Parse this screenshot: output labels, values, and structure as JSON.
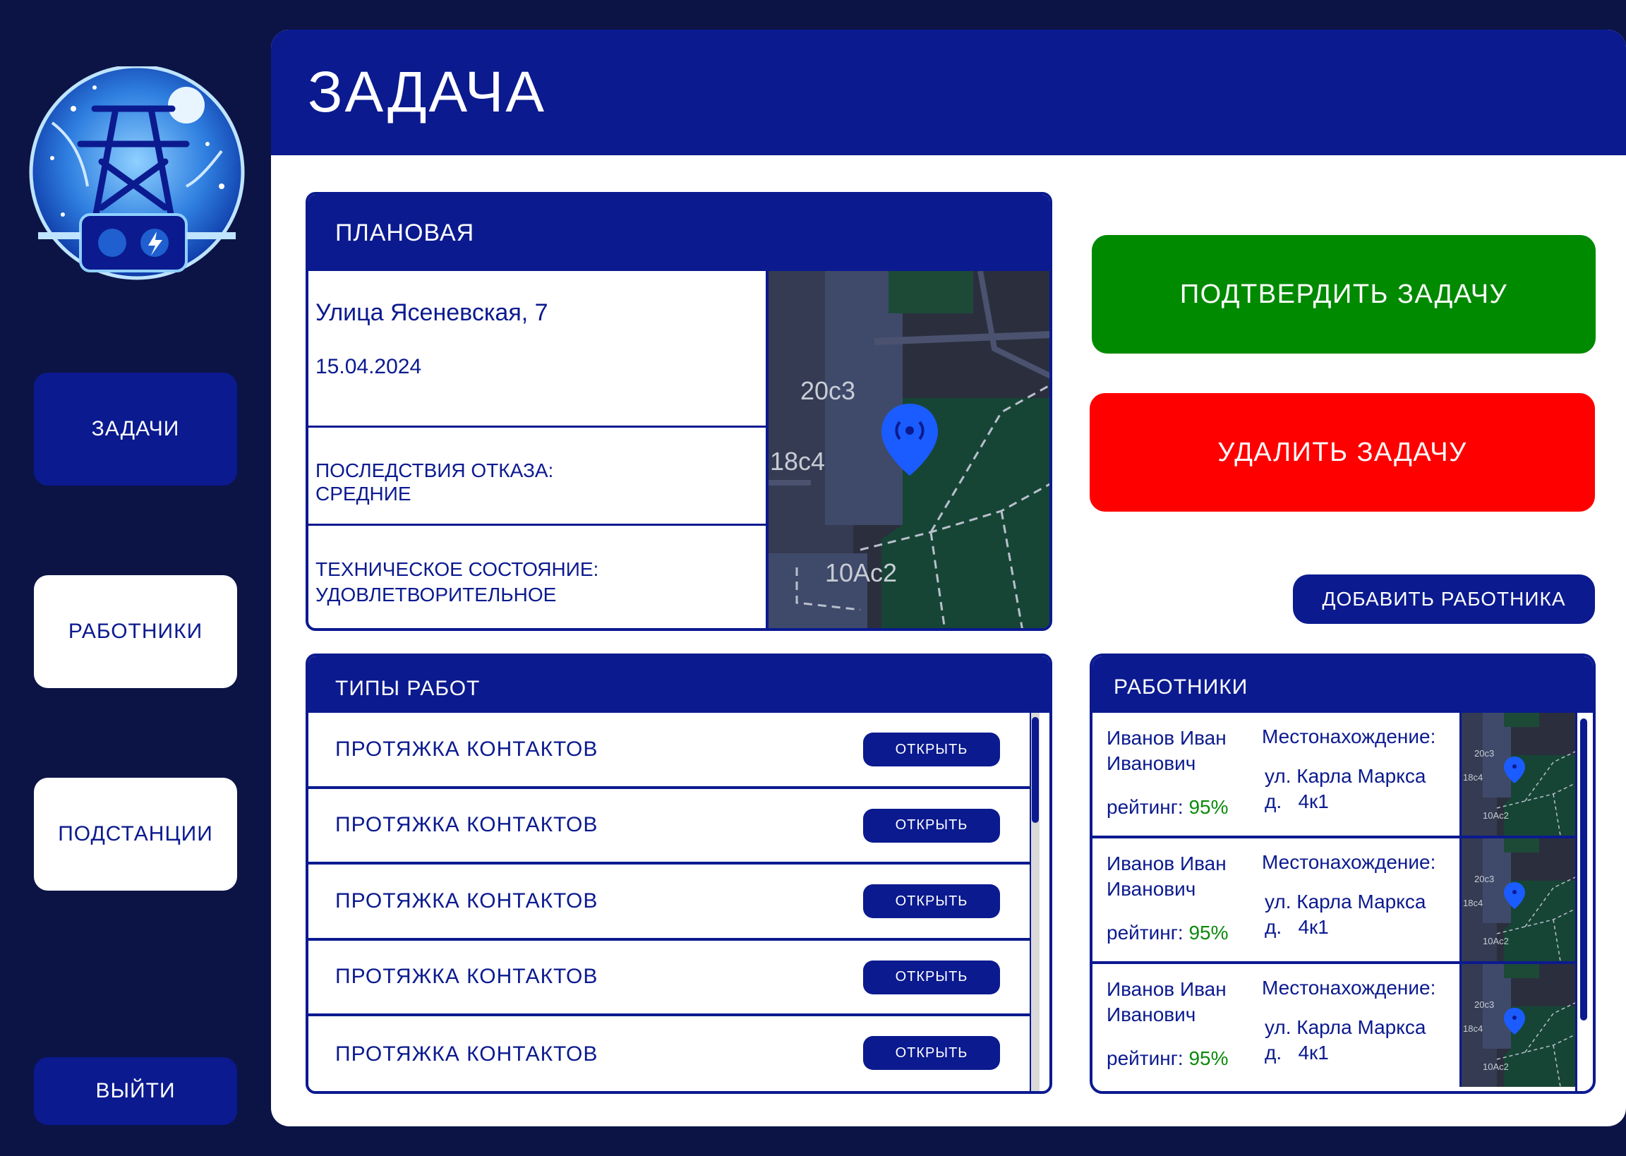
{
  "page": {
    "title": "ЗАДАЧА"
  },
  "sidebar": {
    "items": [
      {
        "label": "ЗАДАЧИ"
      },
      {
        "label": "РАБОТНИКИ"
      },
      {
        "label": "ПОДСТАНЦИИ"
      }
    ],
    "logout": "ВЫЙТИ"
  },
  "task": {
    "type": "ПЛАНОВАЯ",
    "address": "Улица Ясеневская, 7",
    "date": "15.04.2024",
    "consequences": "ПОСЛЕДСТВИЯ ОТКАЗА:",
    "consequences_value": "СРЕДНИЕ",
    "tech_state": "ТЕХНИЧЕСКОЕ СОСТОЯНИЕ:",
    "tech_state_value": "УДОВЛЕТВОРИТЕЛЬНОЕ",
    "map_labels": [
      "20с3",
      "18с4",
      "10Ас2"
    ]
  },
  "actions": {
    "confirm": "ПОДТВЕРДИТЬ ЗАДАЧУ",
    "delete": "УДАЛИТЬ ЗАДАЧУ",
    "add_worker": "ДОБАВИТЬ РАБОТНИКА"
  },
  "work_types": {
    "title": "ТИПЫ РАБОТ",
    "open_label": "ОТКРЫТЬ",
    "items": [
      "ПРОТЯЖКА КОНТАКТОВ",
      "ПРОТЯЖКА КОНТАКТОВ",
      "ПРОТЯЖКА КОНТАКТОВ",
      "ПРОТЯЖКА КОНТАКТОВ",
      "ПРОТЯЖКА КОНТАКТОВ"
    ]
  },
  "workers": {
    "title": "РАБОТНИКИ",
    "location_label": "Местонахождение:",
    "rating_label": "рейтинг: ",
    "items": [
      {
        "name_1": "Иванов Иван",
        "name_2": "Иванович",
        "rating": "95%",
        "loc_1": "ул. Карла Маркса",
        "loc_2": "д.   4к1"
      },
      {
        "name_1": "Иванов Иван",
        "name_2": "Иванович",
        "rating": "95%",
        "loc_1": "ул. Карла Маркса",
        "loc_2": "д.   4к1"
      },
      {
        "name_1": "Иванов Иван",
        "name_2": "Иванович",
        "rating": "95%",
        "loc_1": "ул. Карла Маркса",
        "loc_2": "д.   4к1"
      }
    ],
    "mini_map_labels": [
      "20с3",
      "18с4",
      "10Ас2"
    ]
  },
  "colors": {
    "background": "#0c1446",
    "primary": "#0b1a8f",
    "confirm": "#008a00",
    "delete": "#ff0000",
    "rating": "#0b8a0b"
  },
  "icons": [
    "logo-power-pylon-icon",
    "map-pin-icon",
    "scrollbar"
  ]
}
